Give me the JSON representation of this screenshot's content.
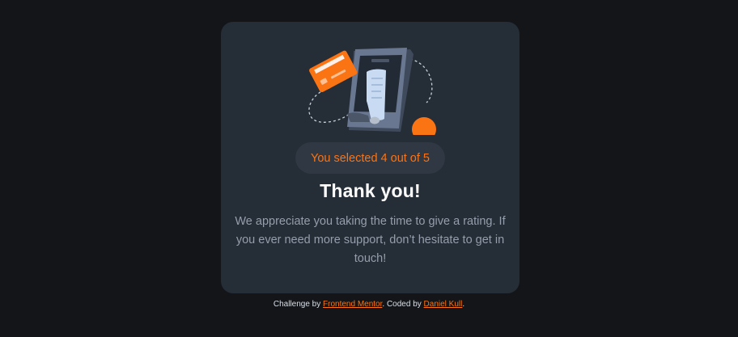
{
  "card": {
    "illustration_icon": "payment-phone-illustration",
    "selection": "You selected 4 out of 5",
    "rating": 4,
    "rating_max": 5,
    "title": "Thank you!",
    "message": "We appreciate you taking the time to give a rating. If you ever need more support, don’t hesitate to get in touch!"
  },
  "attribution": {
    "prefix": "Challenge by ",
    "challenge_link": "Frontend Mentor",
    "middle": ". Coded by ",
    "author_link": "Daniel Kull",
    "suffix": "."
  },
  "colors": {
    "page_bg": "#131518",
    "card_bg": "#252d37",
    "accent": "#fb7413",
    "text_muted": "#959eac",
    "white": "#ffffff"
  }
}
